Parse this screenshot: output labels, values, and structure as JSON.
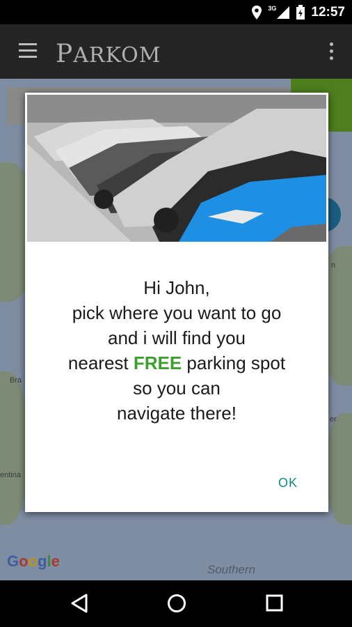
{
  "status_bar": {
    "time": "12:57",
    "network": "3G",
    "icons": [
      "location-icon",
      "signal-icon",
      "battery-icon"
    ]
  },
  "app_bar": {
    "logo_first": "P",
    "logo_rest": "ARKOM",
    "icons": [
      "menu-icon",
      "more-vert-icon"
    ]
  },
  "map": {
    "google_letters": [
      "G",
      "o",
      "o",
      "g",
      "l",
      "e"
    ],
    "label_southern": "Southern",
    "edge_labels": [
      "Bra",
      "entina",
      "n",
      "er"
    ]
  },
  "dialog": {
    "line1": "Hi John,",
    "line2": "pick where you want to go",
    "line3": "and i will find you",
    "line4_pre": "nearest ",
    "line4_highlight": "FREE",
    "line4_post": " parking spot",
    "line5": "so you can",
    "line6": "navigate there!",
    "ok_label": "OK",
    "image": "parked-cars-photo",
    "highlight_color": "#3aa12b",
    "button_color": "#0f8a7a"
  },
  "nav_bar": {
    "icons": [
      "back-icon",
      "home-icon",
      "recents-icon"
    ]
  }
}
